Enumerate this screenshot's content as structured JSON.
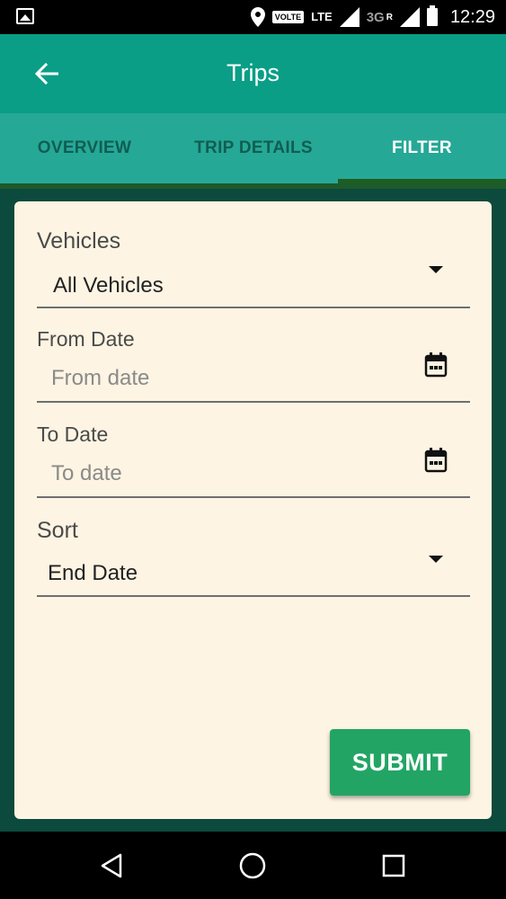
{
  "status_bar": {
    "network_label": "VOLTE",
    "lte_label": "LTE",
    "net_3g_label": "3G",
    "roaming_label": "R",
    "time": "12:29"
  },
  "app_bar": {
    "title": "Trips",
    "back_icon": "arrow-back-icon"
  },
  "tabs": [
    {
      "label": "OVERVIEW",
      "active": false
    },
    {
      "label": "TRIP DETAILS",
      "active": false
    },
    {
      "label": "FILTER",
      "active": true
    }
  ],
  "form": {
    "vehicles": {
      "label": "Vehicles",
      "value": "All Vehicles"
    },
    "from_date": {
      "label": "From Date",
      "placeholder": "From date"
    },
    "to_date": {
      "label": "To Date",
      "placeholder": "To date"
    },
    "sort": {
      "label": "Sort",
      "value": "End Date"
    },
    "submit_label": "SUBMIT"
  },
  "nav_bar": {
    "back_icon": "nav-back-icon",
    "home_icon": "nav-home-icon",
    "recents_icon": "nav-recents-icon"
  },
  "colors": {
    "app_bar": "#0a9e86",
    "tabs": "#26a897",
    "card": "#fdf4e3",
    "submit": "#22a564",
    "background": "#0b4a3c"
  }
}
